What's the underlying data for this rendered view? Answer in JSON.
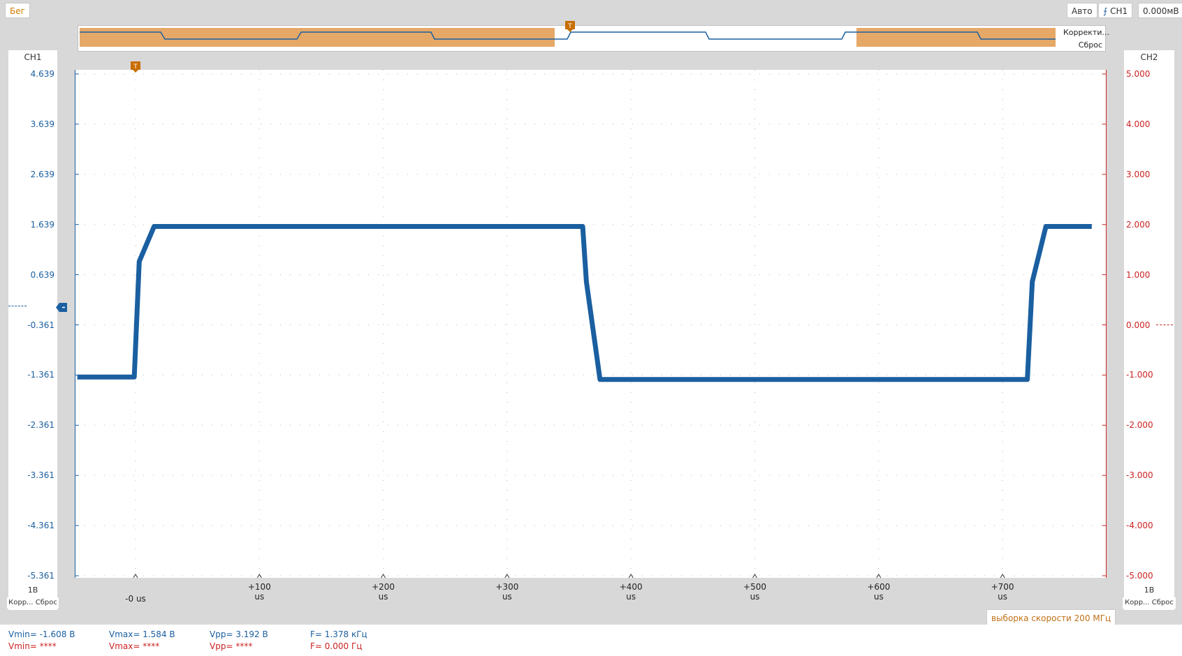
{
  "toolbar": {
    "run_label": "Бег",
    "mode_label": "Авто",
    "trigger_channel": "CH1",
    "trigger_level": "0.000мВ"
  },
  "overview": {
    "correct_label": "Корректи...",
    "reset_label": "Сброс"
  },
  "ch1": {
    "header": "CH1",
    "ticks": [
      "4.639",
      "3.639",
      "2.639",
      "1.639",
      "0.639",
      "-0.361",
      "-1.361",
      "-2.361",
      "-3.361",
      "-4.361",
      "-5.361"
    ],
    "scale": "1В",
    "footer": "Корр... Сброс",
    "color": "#1a5fa0"
  },
  "ch2": {
    "header": "CH2",
    "ticks": [
      "5.000",
      "4.000",
      "3.000",
      "2.000",
      "1.000",
      "0.000",
      "-1.000",
      "-2.000",
      "-3.000",
      "-4.000",
      "-5.000"
    ],
    "scale": "1В",
    "footer": "Корр... Сброс",
    "color": "#cc2222"
  },
  "xaxis": {
    "ticks": [
      "-0 us",
      "+100 us",
      "+200 us",
      "+300 us",
      "+400 us",
      "+500 us",
      "+600 us",
      "+700 us"
    ]
  },
  "sample_rate": "выборка скорости 200 МГц",
  "measurements": {
    "row1": [
      "Vmin= -1.608 В",
      "Vmax= 1.584 В",
      "Vpp= 3.192 В",
      "F= 1.378 кГц"
    ],
    "row2": [
      "Vmin= ****",
      "Vmax= ****",
      "Vpp= ****",
      "F= 0.000 Гц"
    ]
  },
  "chart_data": {
    "type": "line",
    "series": [
      {
        "name": "CH1",
        "x": [
          -47,
          -1,
          3,
          15,
          361,
          364,
          375,
          720,
          724,
          735,
          772
        ],
        "y": [
          -1.4,
          -1.4,
          0.9,
          1.6,
          1.6,
          0.5,
          -1.45,
          -1.45,
          0.5,
          1.6,
          1.6
        ]
      }
    ],
    "xlim": [
      -47,
      772
    ],
    "ylim": [
      -5.361,
      4.639
    ],
    "grid": true,
    "color": "#1a5fa0"
  }
}
